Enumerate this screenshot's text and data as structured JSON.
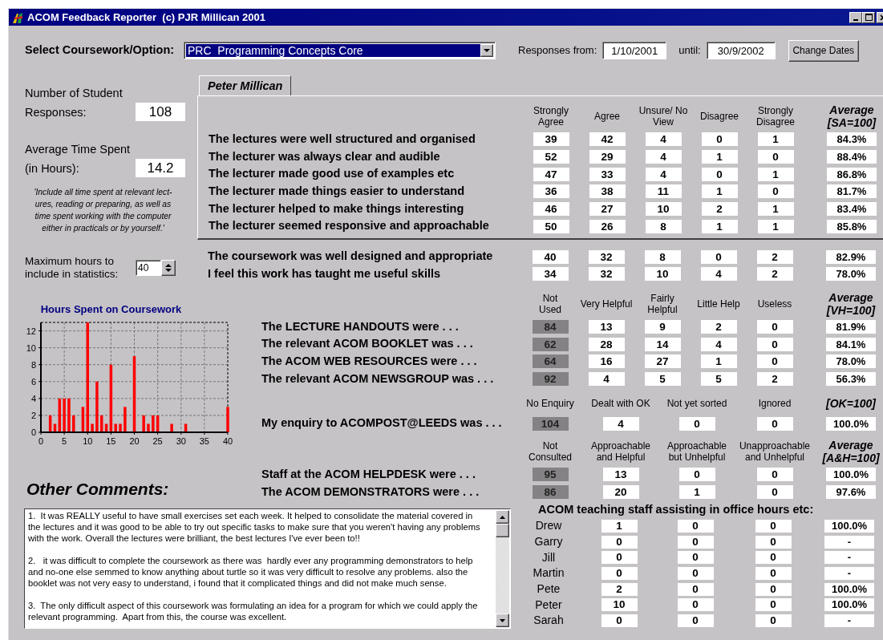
{
  "window": {
    "title": "ACOM Feedback Reporter  (c) PJR Millican 2001"
  },
  "course_select": {
    "label": "Select Coursework/Option:",
    "value": "PRC  Programming Concepts Core"
  },
  "date_range": {
    "from_label": "Responses from:",
    "from": "1/10/2001",
    "until_label": "until:",
    "until": "30/9/2002",
    "button": "Change Dates"
  },
  "summary": {
    "responses_label": "Number of Student\nResponses:",
    "responses": "108",
    "time_label": "Average Time Spent\n(in Hours):",
    "time": "14.2",
    "note": "'Include all time spent at relevant lect-\nures, reading or preparing, as well as\ntime spent working with the computer\neither in practicals or by yourself.'"
  },
  "max_hours": {
    "label": "Maximum hours to\ninclude in statistics:",
    "value": "40"
  },
  "chart": {
    "chart_data": {
      "type": "bar",
      "title": "Hours Spent on Coursework",
      "x": [
        2,
        3,
        4,
        5,
        6,
        7,
        9,
        10,
        11,
        12,
        13,
        14,
        15,
        16,
        17,
        18,
        20,
        22,
        23,
        24,
        25,
        28,
        31,
        40
      ],
      "values": [
        2,
        1,
        4,
        4,
        4,
        2,
        3,
        13,
        1,
        6,
        2,
        1,
        8,
        1,
        1,
        3,
        9,
        2,
        1,
        2,
        2,
        1,
        1,
        3
      ],
      "xlim": [
        0,
        40
      ],
      "ylim": [
        0,
        13
      ],
      "xticks": [
        0,
        5,
        10,
        15,
        20,
        25,
        30,
        35,
        40
      ],
      "yticks": [
        0,
        2,
        4,
        6,
        8,
        10,
        12
      ],
      "grid": true
    }
  },
  "comments": {
    "title": "Other Comments:",
    "text": "1.  It was REALLY useful to have small exercises set each week. It helped to consolidate the material covered in\nthe lectures and it was good to be able to try out specific tasks to make sure that you weren't having any problems\nwith the work. Overall the lectures were brilliant, the best lectures I've ever been to!!\n\n2.   it was difficult to complete the coursework as there was  hardly ever any programming demonstrators to help\nand no-one else semmed to know anything about turtle so it was very difficult to resolve any problems. also the\nbooklet was not very easy to understand, i found that it complicated things and did not make much sense.\n\n3.  The only difficult aspect of this coursework was formulating an idea for a program for which we could apply the\nrelevant programming.  Apart from this, the course was excellent."
  },
  "tab_panel": {
    "tabs": [
      {
        "label": "Peter Millican",
        "selected": true
      }
    ],
    "section": {
      "kind": "agreement",
      "columns": [
        "Strongly\nAgree",
        "Agree",
        "Unsure/ No\nView",
        "Disagree",
        "Strongly\nDisagree"
      ],
      "average_header": "Average\n[SA=100]",
      "rows": [
        {
          "statement": "The lectures were well structured and organised",
          "values": [
            "39",
            "42",
            "4",
            "0",
            "1"
          ],
          "average": "84.3%"
        },
        {
          "statement": "The lecturer was always clear and audible",
          "values": [
            "52",
            "29",
            "4",
            "1",
            "0"
          ],
          "average": "88.4%"
        },
        {
          "statement": "The lecturer made good use of examples etc",
          "values": [
            "47",
            "33",
            "4",
            "0",
            "1"
          ],
          "average": "86.8%"
        },
        {
          "statement": "The lecturer made things easier to understand",
          "values": [
            "36",
            "38",
            "11",
            "1",
            "0"
          ],
          "average": "81.7%"
        },
        {
          "statement": "The lecturer helped to make things interesting",
          "values": [
            "46",
            "27",
            "10",
            "2",
            "1"
          ],
          "average": "83.4%"
        },
        {
          "statement": "The lecturer seemed responsive and approachable",
          "values": [
            "50",
            "26",
            "8",
            "1",
            "1"
          ],
          "average": "85.8%"
        }
      ]
    }
  },
  "sections": [
    {
      "kind": "agreement",
      "rows": [
        {
          "statement": "The coursework was well designed and appropriate",
          "values": [
            "40",
            "32",
            "8",
            "0",
            "2"
          ],
          "average": "82.9%"
        },
        {
          "statement": "I feel this work has taught me useful skills",
          "values": [
            "34",
            "32",
            "10",
            "4",
            "2"
          ],
          "average": "78.0%"
        }
      ]
    },
    {
      "kind": "usefulness",
      "columns": [
        "Not\nUsed",
        "Very Helpful",
        "Fairly\nHelpful",
        "Little Help",
        "Useless"
      ],
      "average_header": "Average\n[VH=100]",
      "rows": [
        {
          "statement": "The LECTURE HANDOUTS were . . .",
          "values": [
            "84",
            "13",
            "9",
            "2",
            "0"
          ],
          "average": "81.9%"
        },
        {
          "statement": "The relevant ACOM BOOKLET was . . .",
          "values": [
            "62",
            "28",
            "14",
            "4",
            "0"
          ],
          "average": "84.1%"
        },
        {
          "statement": "The ACOM WEB RESOURCES were . . .",
          "values": [
            "64",
            "16",
            "27",
            "1",
            "0"
          ],
          "average": "78.0%"
        },
        {
          "statement": "The relevant ACOM NEWSGROUP was . . .",
          "values": [
            "92",
            "4",
            "5",
            "5",
            "2"
          ],
          "average": "56.3%"
        }
      ]
    },
    {
      "kind": "enquiry",
      "columns": [
        "No Enquiry",
        "Dealt with OK",
        "Not yet sorted",
        "Ignored"
      ],
      "average_header": "[OK=100]",
      "rows": [
        {
          "statement": "My enquiry to ACOMPOST@LEEDS was . . .",
          "values": [
            "104",
            "4",
            "0",
            "0"
          ],
          "average": "100.0%"
        }
      ]
    },
    {
      "kind": "support",
      "columns": [
        "Not\nConsulted",
        "Approachable\nand Helpful",
        "Approachable\nbut Unhelpful",
        "Unapproachable\nand Unhelpful"
      ],
      "average_header": "Average\n[A&H=100]",
      "rows": [
        {
          "statement": "Staff at the ACOM HELPDESK were . . .",
          "values": [
            "95",
            "13",
            "0",
            "0"
          ],
          "average": "100.0%"
        },
        {
          "statement": "The ACOM DEMONSTRATORS were . . .",
          "values": [
            "86",
            "20",
            "1",
            "0"
          ],
          "average": "97.6%"
        }
      ]
    }
  ],
  "staff": {
    "title": "ACOM teaching staff assisting in office hours etc:",
    "rows": [
      {
        "name": "Drew",
        "values": [
          "1",
          "0",
          "0"
        ],
        "average": "100.0%"
      },
      {
        "name": "Garry",
        "values": [
          "0",
          "0",
          "0"
        ],
        "average": "-"
      },
      {
        "name": "Jill",
        "values": [
          "0",
          "0",
          "0"
        ],
        "average": "-"
      },
      {
        "name": "Martin",
        "values": [
          "0",
          "0",
          "0"
        ],
        "average": "-"
      },
      {
        "name": "Pete",
        "values": [
          "2",
          "0",
          "0"
        ],
        "average": "100.0%"
      },
      {
        "name": "Peter",
        "values": [
          "10",
          "0",
          "0"
        ],
        "average": "100.0%"
      },
      {
        "name": "Sarah",
        "values": [
          "0",
          "0",
          "0"
        ],
        "average": "-"
      }
    ]
  }
}
